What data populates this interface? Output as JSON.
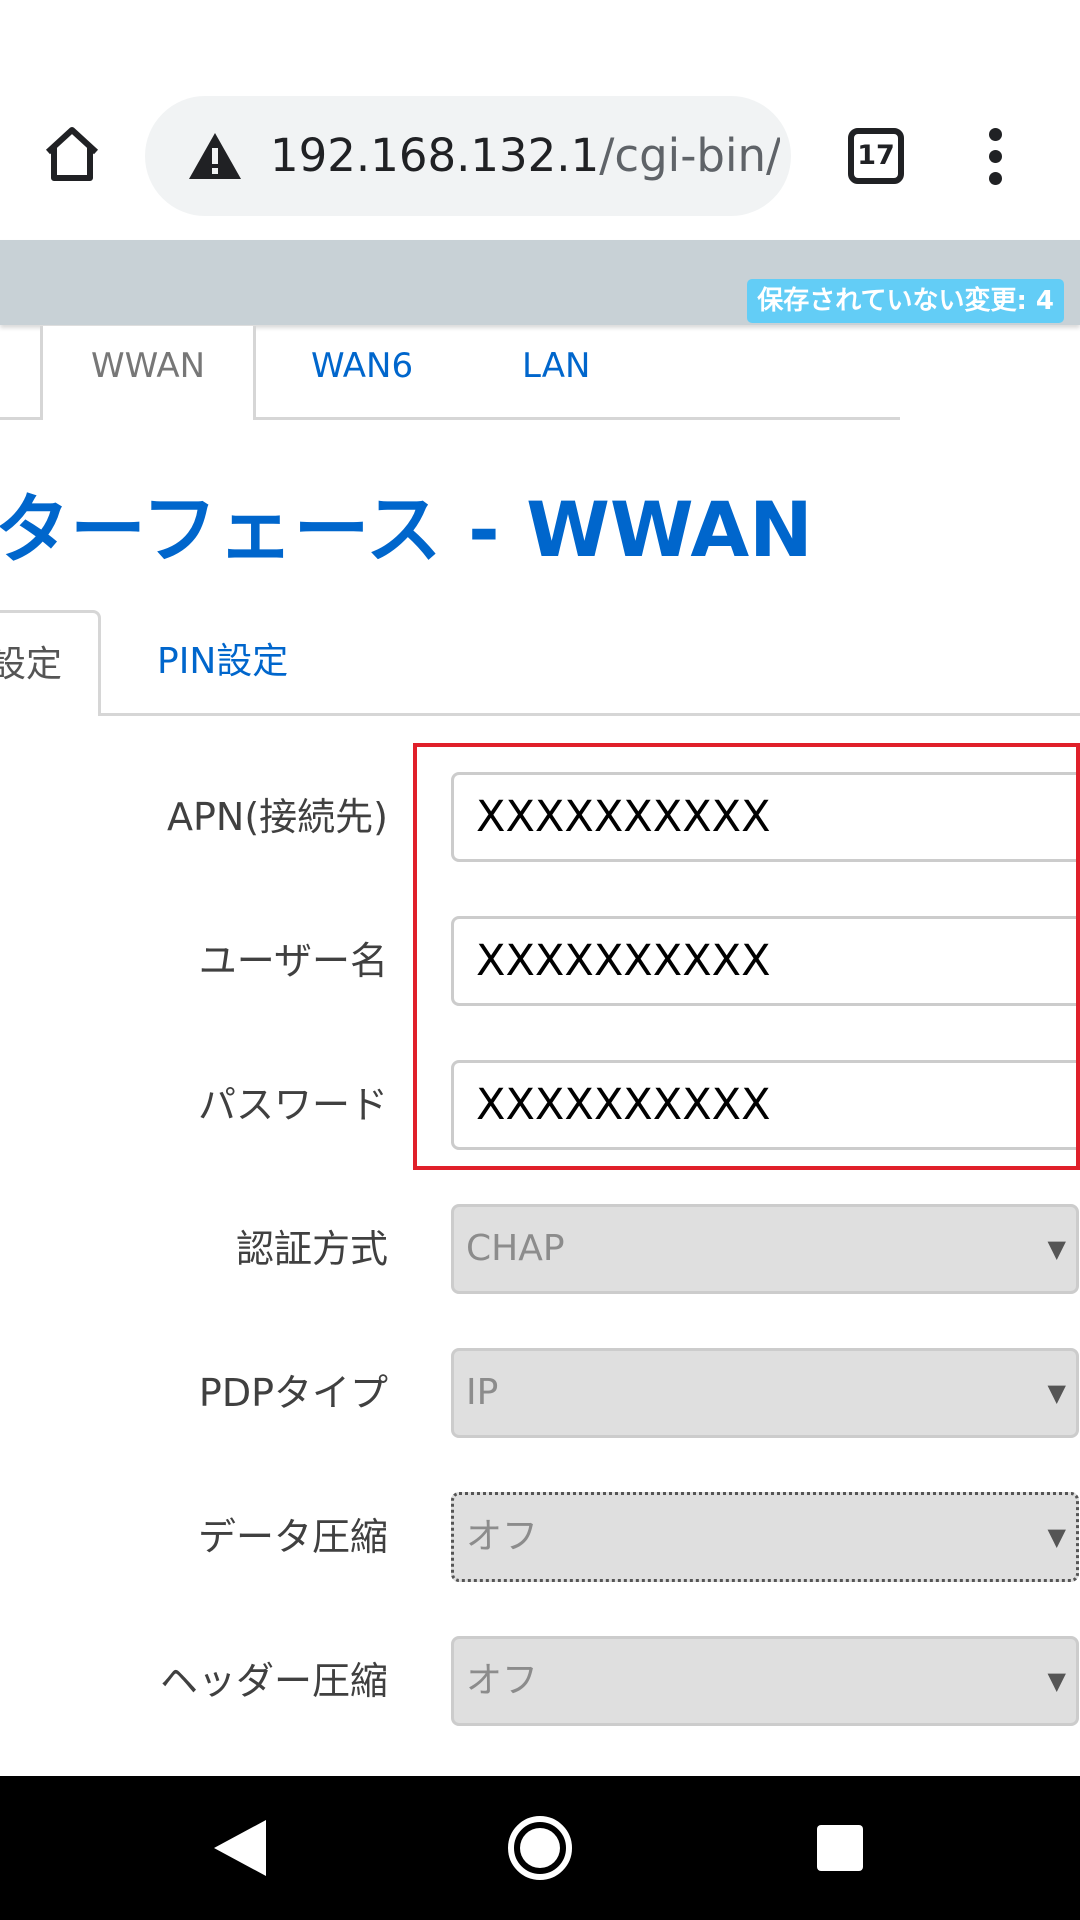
{
  "browser": {
    "url_host": "192.168.132.1",
    "url_path": "/cgi-bin/",
    "tab_count": "17",
    "icons": [
      "home-icon",
      "warning-icon",
      "tabs-icon",
      "more-vert-icon"
    ]
  },
  "header": {
    "unsaved_changes": "保存されていない変更: 4"
  },
  "main_tabs": {
    "active": "WWAN",
    "items": [
      "WAN6",
      "LAN"
    ]
  },
  "page": {
    "title": "ターフェース - WWAN"
  },
  "sub_tabs": {
    "active": "設定",
    "pin": "PIN設定"
  },
  "form": {
    "fields": [
      {
        "label": "APN(接続先)",
        "value": "XXXXXXXXXX"
      },
      {
        "label": "ユーザー名",
        "value": "XXXXXXXXXX"
      },
      {
        "label": "パスワード",
        "value": "XXXXXXXXXX"
      }
    ],
    "selects": [
      {
        "label": "認証方式",
        "value": "CHAP"
      },
      {
        "label": "PDPタイプ",
        "value": "IP"
      },
      {
        "label": "データ圧縮",
        "value": "オフ"
      },
      {
        "label": "ヘッダー圧縮",
        "value": "オフ"
      }
    ],
    "select_arrow": "▼"
  },
  "colors": {
    "link": "#0066cc",
    "highlight": "#e0202a",
    "badge": "#63cdf6",
    "header": "#c8d1d6"
  },
  "nav": {
    "icons": [
      "back-icon",
      "home-circle-icon",
      "recents-icon"
    ]
  }
}
